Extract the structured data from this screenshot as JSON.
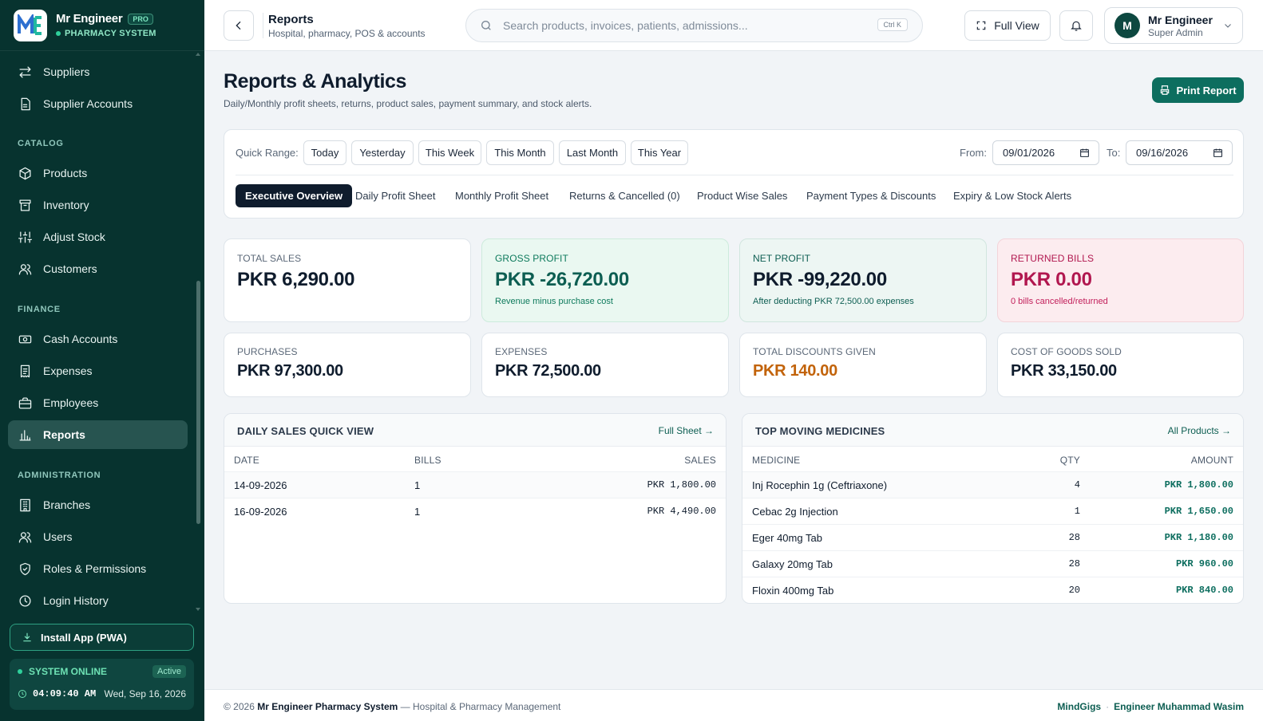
{
  "brand": {
    "name": "Mr Engineer",
    "badge": "PRO",
    "subtitle": "PHARMACY SYSTEM"
  },
  "sidebar": {
    "items": [
      {
        "label": "Suppliers",
        "icon": "arrows-swap-icon"
      },
      {
        "label": "Supplier Accounts",
        "icon": "document-icon"
      },
      {
        "label": "Products",
        "icon": "box-icon"
      },
      {
        "label": "Inventory",
        "icon": "archive-icon"
      },
      {
        "label": "Adjust Stock",
        "icon": "sliders-icon"
      },
      {
        "label": "Customers",
        "icon": "users-icon"
      },
      {
        "label": "Cash Accounts",
        "icon": "cash-icon"
      },
      {
        "label": "Expenses",
        "icon": "receipt-icon"
      },
      {
        "label": "Employees",
        "icon": "briefcase-icon"
      },
      {
        "label": "Reports",
        "icon": "bar-chart-icon"
      },
      {
        "label": "Branches",
        "icon": "building-icon"
      },
      {
        "label": "Users",
        "icon": "users-icon"
      },
      {
        "label": "Roles & Permissions",
        "icon": "shield-icon"
      },
      {
        "label": "Login History",
        "icon": "clock-icon"
      }
    ],
    "sections": {
      "catalog": "CATALOG",
      "finance": "FINANCE",
      "administration": "ADMINISTRATION"
    },
    "install_label": "Install App (PWA)",
    "status": {
      "label": "SYSTEM ONLINE",
      "badge": "Active",
      "time": "04:09:40 AM",
      "date": "Wed, Sep 16, 2026"
    }
  },
  "topbar": {
    "title": "Reports",
    "subtitle": "Hospital, pharmacy, POS & accounts",
    "search_placeholder": "Search products, invoices, patients, admissions...",
    "shortcut": "Ctrl K",
    "fullview_label": "Full View",
    "user": {
      "initial": "M",
      "name": "Mr Engineer",
      "role": "Super Admin"
    }
  },
  "page": {
    "title": "Reports & Analytics",
    "subtitle": "Daily/Monthly profit sheets, returns, product sales, payment summary, and stock alerts.",
    "print_label": "Print Report"
  },
  "filters": {
    "quick_range_label": "Quick Range:",
    "ranges": [
      "Today",
      "Yesterday",
      "This Week",
      "This Month",
      "Last Month",
      "This Year"
    ],
    "from_label": "From:",
    "from_value": "09/01/2026",
    "to_label": "To:",
    "to_value": "09/16/2026",
    "tabs": [
      "Executive Overview",
      "Daily Profit Sheet",
      "Monthly Profit Sheet",
      "Returns & Cancelled (0)",
      "Product Wise Sales",
      "Payment Types & Discounts",
      "Expiry & Low Stock Alerts"
    ]
  },
  "stats": [
    {
      "label": "TOTAL SALES",
      "value": "PKR 6,290.00"
    },
    {
      "label": "GROSS PROFIT",
      "value": "PKR -26,720.00",
      "note": "Revenue minus purchase cost"
    },
    {
      "label": "NET PROFIT",
      "value": "PKR -99,220.00",
      "note": "After deducting PKR 72,500.00 expenses"
    },
    {
      "label": "RETURNED BILLS",
      "value": "PKR 0.00",
      "note": "0 bills cancelled/returned"
    },
    {
      "label": "PURCHASES",
      "value": "PKR 97,300.00"
    },
    {
      "label": "EXPENSES",
      "value": "PKR 72,500.00"
    },
    {
      "label": "TOTAL DISCOUNTS GIVEN",
      "value": "PKR 140.00"
    },
    {
      "label": "COST OF GOODS SOLD",
      "value": "PKR 33,150.00"
    }
  ],
  "daily_sales": {
    "title": "DAILY SALES QUICK VIEW",
    "link": "Full Sheet →",
    "columns": [
      "DATE",
      "BILLS",
      "SALES"
    ],
    "rows": [
      {
        "date": "14-09-2026",
        "bills": "1",
        "sales": "PKR 1,800.00"
      },
      {
        "date": "16-09-2026",
        "bills": "1",
        "sales": "PKR 4,490.00"
      }
    ]
  },
  "top_medicines": {
    "title": "TOP MOVING MEDICINES",
    "link": "All Products →",
    "columns": [
      "MEDICINE",
      "QTY",
      "AMOUNT"
    ],
    "rows": [
      {
        "medicine": "Inj Rocephin 1g (Ceftriaxone)",
        "qty": "4",
        "amount": "PKR 1,800.00"
      },
      {
        "medicine": "Cebac 2g Injection",
        "qty": "1",
        "amount": "PKR 1,650.00"
      },
      {
        "medicine": "Eger 40mg Tab",
        "qty": "28",
        "amount": "PKR 1,180.00"
      },
      {
        "medicine": "Galaxy 20mg Tab",
        "qty": "28",
        "amount": "PKR 960.00"
      },
      {
        "medicine": "Floxin 400mg Tab",
        "qty": "20",
        "amount": "PKR 840.00"
      }
    ]
  },
  "footer": {
    "copyright": "© 2026",
    "product": "Mr Engineer Pharmacy System",
    "tagline": "— Hospital & Pharmacy Management",
    "credit1": "MindGigs",
    "separator": "·",
    "credit2": "Engineer Muhammad Wasim"
  },
  "colors": {
    "sidebar": "#07332f",
    "accent": "#0d6e5f",
    "profit": "#0d5e52",
    "returned": "#c21e5a",
    "discount": "#c2630a"
  }
}
